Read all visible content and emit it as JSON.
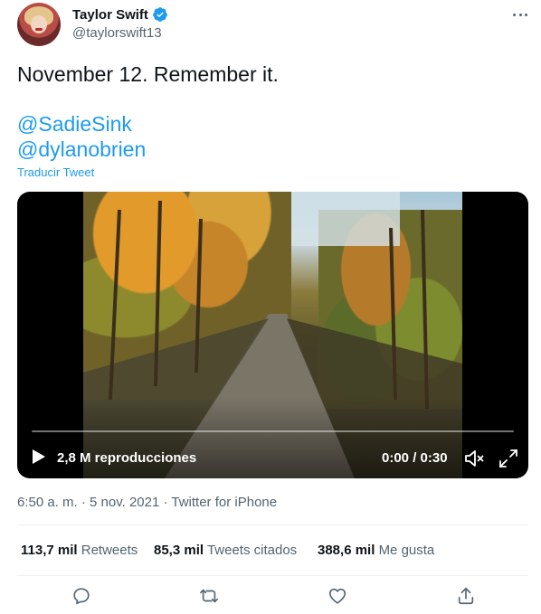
{
  "author": {
    "display_name": "Taylor Swift",
    "handle": "@taylorswift13",
    "verified": true
  },
  "icons": {
    "verified": "verified-badge-icon",
    "more": "more-horizontal-icon",
    "play": "play-icon",
    "volume": "volume-muted-icon",
    "fullscreen": "expand-icon",
    "reply": "reply-icon",
    "retweet": "retweet-icon",
    "like": "heart-icon",
    "share": "share-icon"
  },
  "tweet": {
    "text": "November 12. Remember it.",
    "mentions": [
      "@SadieSink",
      "@dylanobrien"
    ],
    "translate_label": "Traducir Tweet"
  },
  "video": {
    "views_label": "2,8 M reproducciones",
    "time_label": "0:00 / 0:30",
    "progress": 0
  },
  "meta": {
    "timestamp": "6:50 a. m. · 5 nov. 2021 · Twitter for iPhone"
  },
  "stats": [
    {
      "count": "113,7 mil",
      "label": "Retweets"
    },
    {
      "count": "85,3 mil",
      "label": "Tweets citados"
    },
    {
      "count": "388,6 mil",
      "label": "Me gusta"
    }
  ],
  "colors": {
    "accent": "#1d9bf0",
    "text": "#0f1419",
    "secondary": "#536471"
  }
}
